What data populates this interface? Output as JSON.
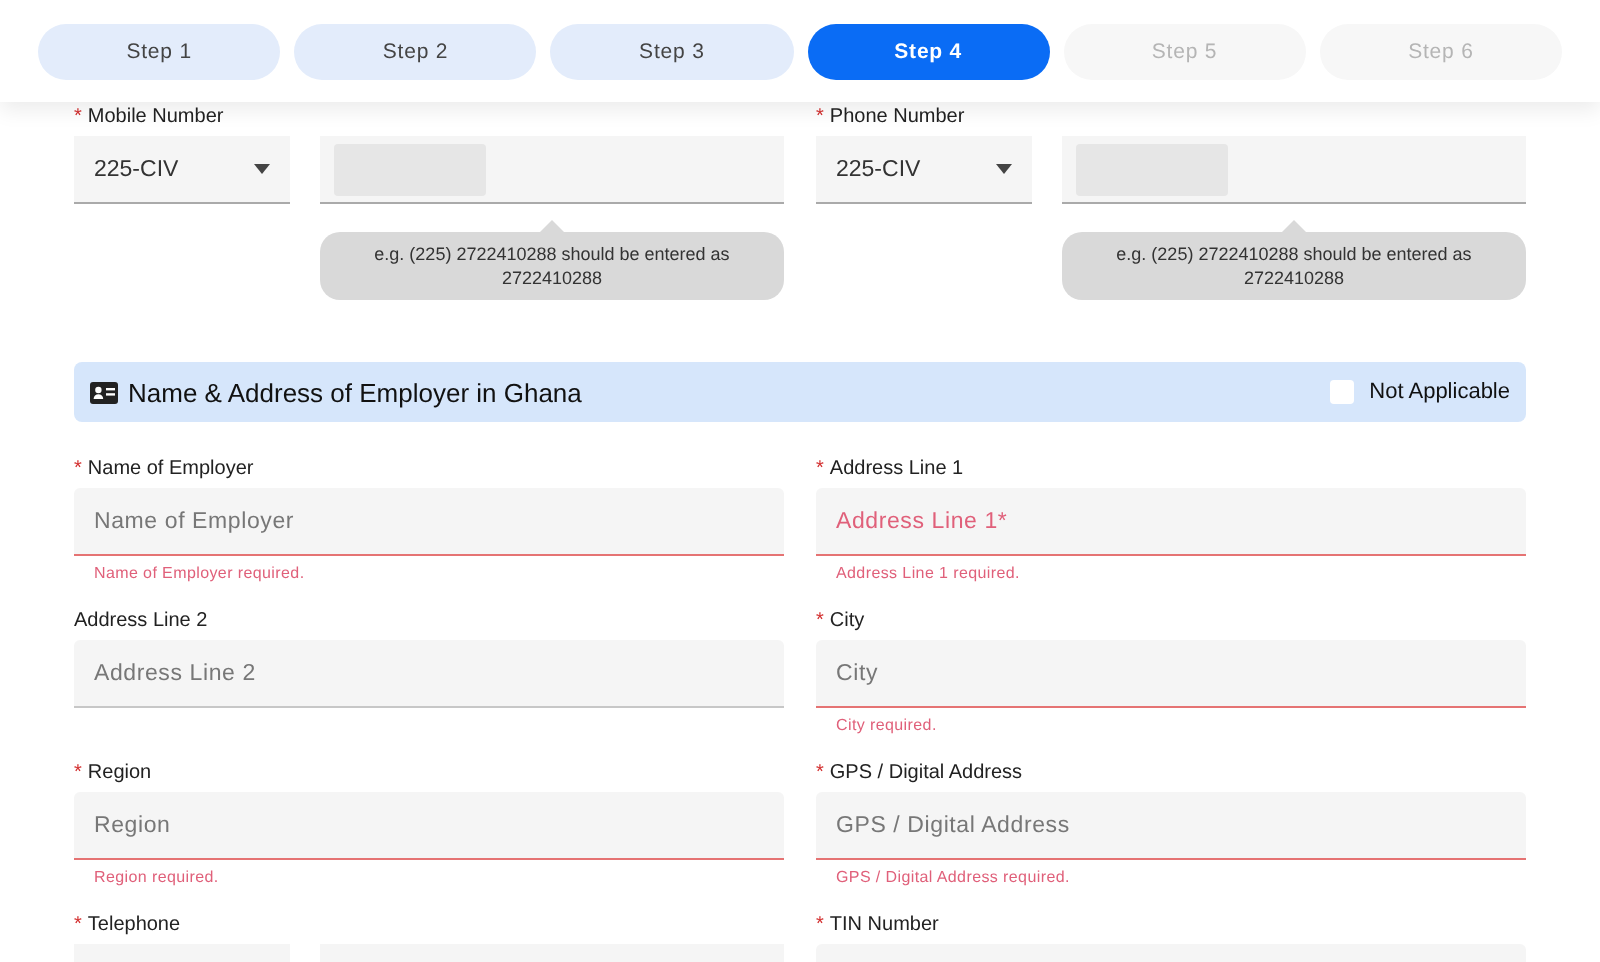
{
  "steps": [
    {
      "label": "Step 1",
      "completed": true,
      "selected": false
    },
    {
      "label": "Step 2",
      "completed": true,
      "selected": false
    },
    {
      "label": "Step 3",
      "completed": true,
      "selected": false
    },
    {
      "label": "Step 4",
      "completed": false,
      "selected": true
    },
    {
      "label": "Step 5",
      "completed": false,
      "selected": false
    },
    {
      "label": "Step 6",
      "completed": false,
      "selected": false
    }
  ],
  "phone_fields": [
    {
      "mark": "*",
      "label": "Mobile Number",
      "code": "225-CIV",
      "hint": "e.g. (225) 2722410288 should be entered as 2722410288"
    },
    {
      "mark": "*",
      "label": "Phone Number",
      "code": "225-CIV",
      "hint": "e.g. (225) 2722410288 should be entered as 2722410288"
    }
  ],
  "section": {
    "title": "Name & Address of Employer in Ghana",
    "not_applicable": {
      "label": "Not Applicable",
      "checked": false
    }
  },
  "fields": [
    {
      "kind": "text",
      "mark": "*",
      "label": "Name of Employer",
      "placeholder": "Name of Employer",
      "error": "Name of Employer required.",
      "highlighted": false
    },
    {
      "kind": "text",
      "mark": "*",
      "label": "Address Line 1",
      "placeholder": "Address Line 1*",
      "error": "Address Line 1 required.",
      "highlighted": true
    },
    {
      "kind": "text",
      "label": "Address Line 2",
      "placeholder": "Address Line 2",
      "highlighted": false
    },
    {
      "kind": "text",
      "mark": "*",
      "label": "City",
      "placeholder": "City",
      "error": "City required.",
      "highlighted": false
    },
    {
      "kind": "text",
      "mark": "*",
      "label": "Region",
      "placeholder": "Region",
      "error": "Region required.",
      "highlighted": false
    },
    {
      "kind": "text",
      "mark": "*",
      "label": "GPS / Digital Address",
      "placeholder": "GPS / Digital Address",
      "error": "GPS / Digital Address required.",
      "highlighted": false
    },
    {
      "kind": "phone",
      "mark": "*",
      "label": "Telephone"
    },
    {
      "kind": "text",
      "mark": "*",
      "label": "TIN Number"
    }
  ]
}
